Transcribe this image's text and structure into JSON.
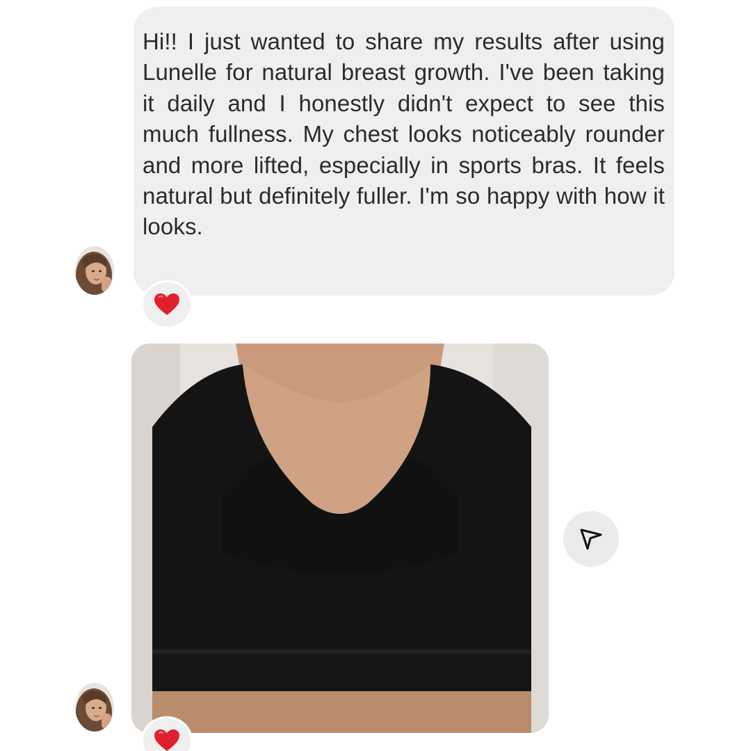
{
  "messages": [
    {
      "type": "text",
      "text": "Hi!! I just wanted to share my results after using Lunelle for natural breast growth. I've been taking it daily and I honestly didn't expect to see this much fullness. My chest looks noticeably rounder and more lifted, especially in sports bras. It feels natural but definitely fuller. I'm so happy with how it looks.",
      "reaction": "heart"
    },
    {
      "type": "photo",
      "reaction": "heart"
    }
  ],
  "actions": {
    "share_icon": "paper-plane-icon"
  },
  "colors": {
    "bubble": "#efefef",
    "text": "#2b2b2b",
    "heart": "#e0202e"
  }
}
